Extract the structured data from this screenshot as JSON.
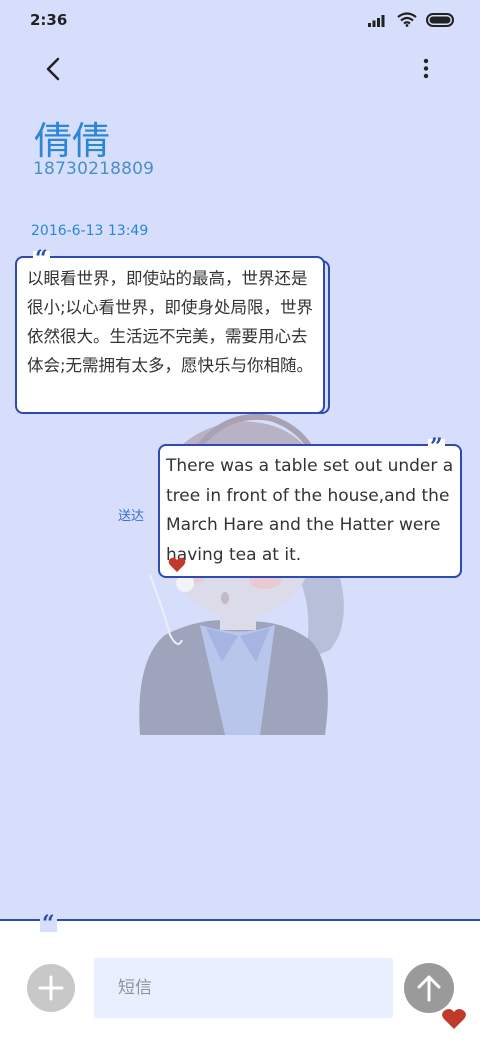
{
  "status_bar": {
    "time": "2:36"
  },
  "contact": {
    "name": "倩倩",
    "phone": "18730218809"
  },
  "conversation": {
    "timestamp": "2016-6-13 13:49",
    "incoming": {
      "text": "以眼看世界，即使站的最高，世界还是很小;以心看世界，即使身处局限，世界依然很大。生活远不完美，需要用心去体会;无需拥有太多，愿快乐与你相随。"
    },
    "outgoing": {
      "text": "There was a table set out under a tree in front of the house,and the March Hare and the Hatter were having tea at it.",
      "status": "送达"
    }
  },
  "composer": {
    "placeholder": "短信"
  },
  "colors": {
    "background": "#d6defb",
    "accent": "#2d4bb1",
    "name_blue": "#2a86d6",
    "heart_red": "#c0392b"
  },
  "icons": [
    "back-arrow-icon",
    "more-vert-icon",
    "signal-icon",
    "wifi-icon",
    "battery-icon",
    "plus-icon",
    "arrow-up-icon",
    "heart-icon",
    "quote-icon"
  ]
}
